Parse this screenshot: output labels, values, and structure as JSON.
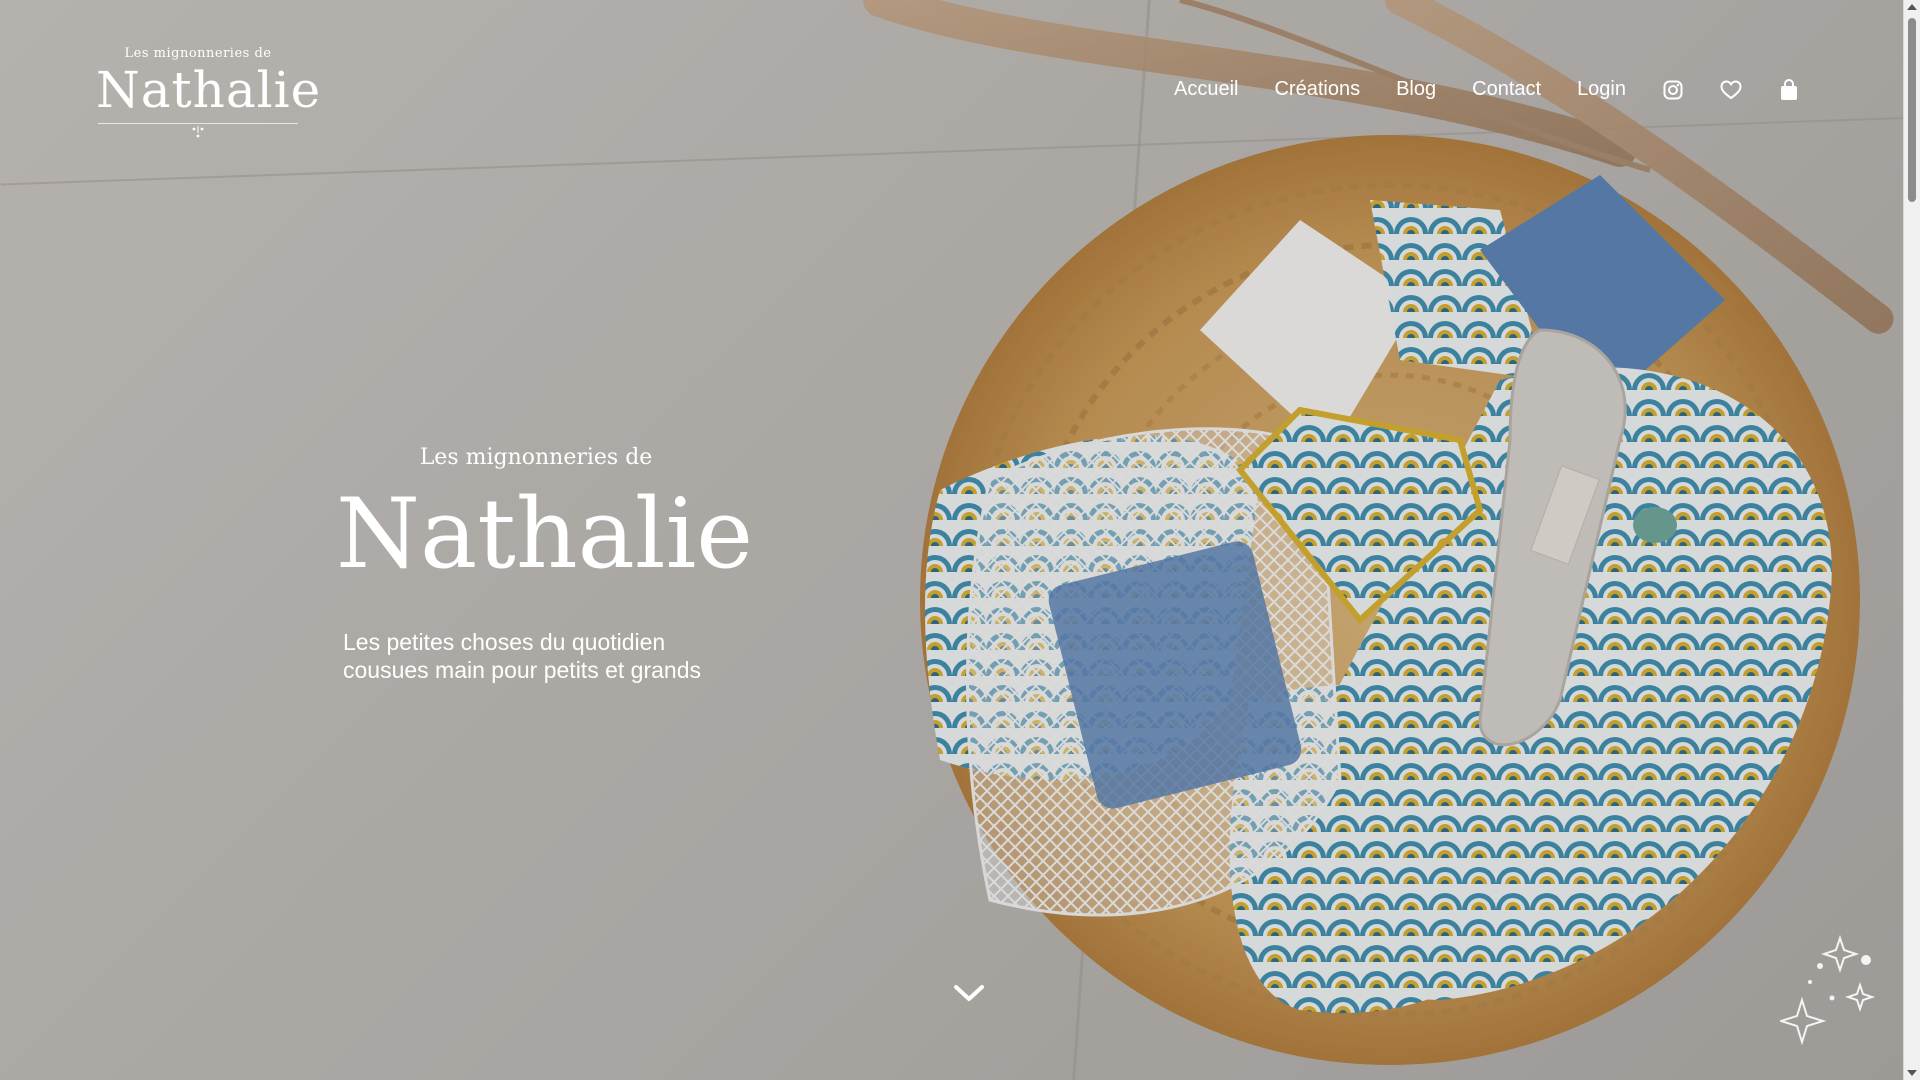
{
  "brand": {
    "logo_small": "Les mignonneries de",
    "logo_big": "Nathalie"
  },
  "nav": {
    "items": [
      {
        "label": "Accueil"
      },
      {
        "label": "Créations"
      },
      {
        "label": "Blog"
      },
      {
        "label": "Contact"
      },
      {
        "label": "Login"
      }
    ],
    "icons": [
      "instagram-icon",
      "heart-icon",
      "shopping-bag-icon"
    ]
  },
  "hero": {
    "subtitle": "Les mignonneries de",
    "title": "Nathalie",
    "tagline_line1": "Les petites choses du quotidien",
    "tagline_line2": "cousues main pour petits et grands"
  },
  "colors": {
    "text": "#ffffff",
    "background": "#bdbab6",
    "jute": "#c89a55",
    "fabric_blue": "#3f8fb0",
    "fabric_yellow": "#d9b12f",
    "towel_blue": "#5b83b6"
  }
}
